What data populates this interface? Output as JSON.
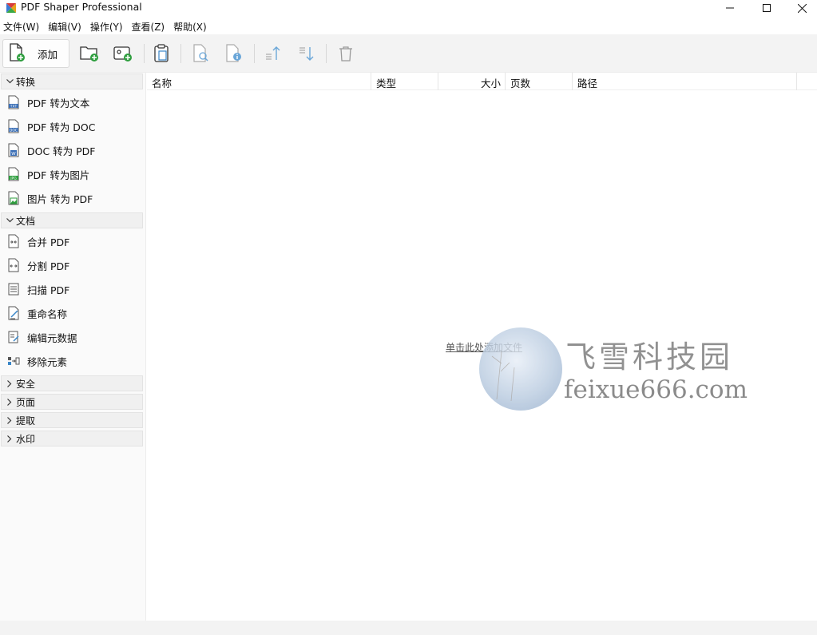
{
  "window": {
    "title": "PDF Shaper Professional"
  },
  "menu": [
    {
      "label": "文件(W)"
    },
    {
      "label": "编辑(V)"
    },
    {
      "label": "操作(Y)"
    },
    {
      "label": "查看(Z)"
    },
    {
      "label": "帮助(X)"
    }
  ],
  "toolbar": {
    "add_label": "添加"
  },
  "sidebar": {
    "groups": [
      {
        "label": "转换",
        "expanded": true,
        "items": [
          {
            "label": "PDF 转为文本",
            "icon": "txt-file-icon"
          },
          {
            "label": "PDF 转为 DOC",
            "icon": "doc-file-icon"
          },
          {
            "label": "DOC 转为 PDF",
            "icon": "word-file-icon"
          },
          {
            "label": "PDF 转为图片",
            "icon": "jpg-file-icon"
          },
          {
            "label": "图片 转为 PDF",
            "icon": "image-file-icon"
          }
        ]
      },
      {
        "label": "文档",
        "expanded": true,
        "items": [
          {
            "label": "合并 PDF",
            "icon": "merge-icon"
          },
          {
            "label": "分割 PDF",
            "icon": "split-icon"
          },
          {
            "label": "扫描 PDF",
            "icon": "scanner-icon"
          },
          {
            "label": "重命名称",
            "icon": "rename-icon"
          },
          {
            "label": "编辑元数据",
            "icon": "metadata-icon"
          },
          {
            "label": "移除元素",
            "icon": "remove-elements-icon"
          }
        ]
      },
      {
        "label": "安全",
        "expanded": false
      },
      {
        "label": "页面",
        "expanded": false
      },
      {
        "label": "提取",
        "expanded": false
      },
      {
        "label": "水印",
        "expanded": false
      }
    ]
  },
  "file_list": {
    "columns": [
      {
        "label": "名称"
      },
      {
        "label": "类型"
      },
      {
        "label": "大小"
      },
      {
        "label": "页数"
      },
      {
        "label": "路径"
      }
    ],
    "empty_hint": "单击此处添加文件"
  },
  "watermark": {
    "cn": "飞雪科技园",
    "en": "feixue666.com",
    "seal": "飞雪"
  },
  "colors": {
    "toolbar_bg": "#f3f3f3",
    "sidebar_bg": "#fafafa",
    "icon_green": "#2e9e3e",
    "icon_blue": "#3a86c8"
  }
}
